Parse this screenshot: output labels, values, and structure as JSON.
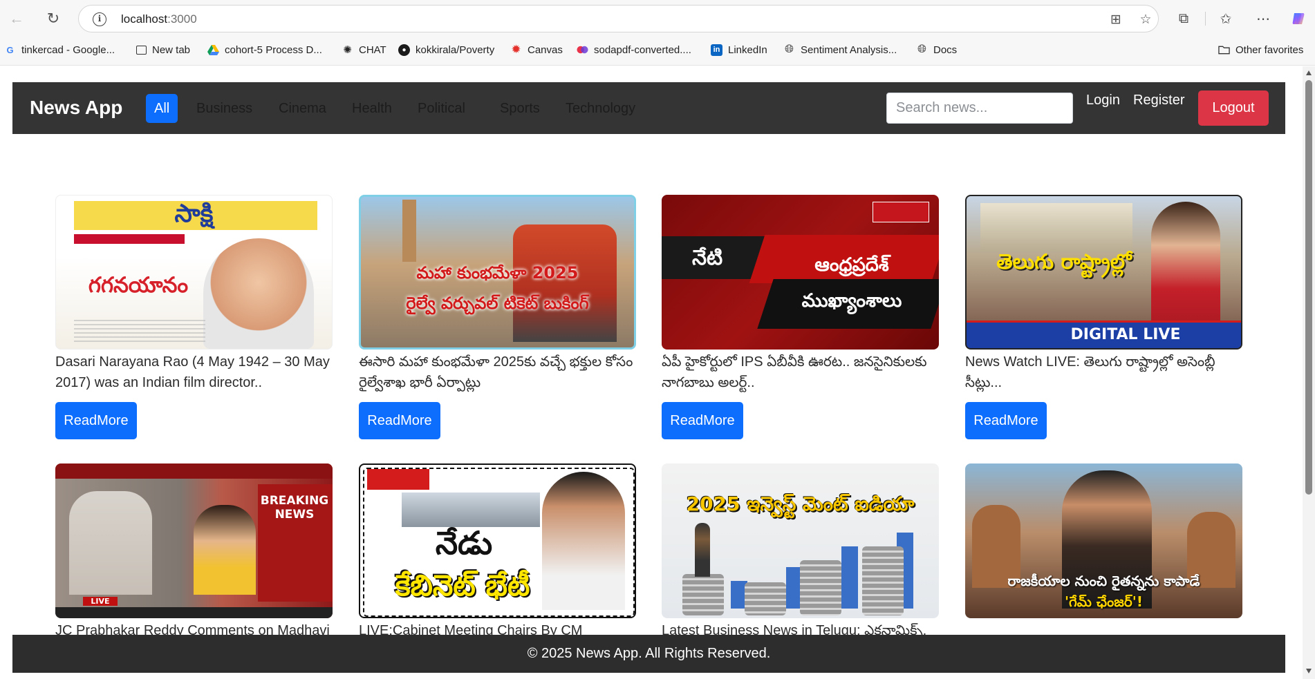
{
  "browser": {
    "url_host": "localhost",
    "url_port": ":3000",
    "bookmarks": [
      {
        "label": "tinkercad - Google...",
        "icon": "google-icon"
      },
      {
        "label": "New tab",
        "icon": "new-tab-icon"
      },
      {
        "label": "cohort-5 Process D...",
        "icon": "drive-icon"
      },
      {
        "label": "CHAT",
        "icon": "chatgpt-icon"
      },
      {
        "label": "kokkirala/Poverty",
        "icon": "github-icon"
      },
      {
        "label": "Canvas",
        "icon": "canvas-icon"
      },
      {
        "label": "sodapdf-converted....",
        "icon": "soda-pdf-icon"
      },
      {
        "label": "LinkedIn",
        "icon": "linkedin-icon"
      },
      {
        "label": "Sentiment Analysis...",
        "icon": "globe-icon"
      },
      {
        "label": "Docs",
        "icon": "globe-icon"
      }
    ],
    "other_favorites": "Other favorites"
  },
  "app": {
    "brand": "News App",
    "categories": [
      "All",
      "Business",
      "Cinema",
      "Health",
      "Political",
      "Sports",
      "Technology"
    ],
    "active_category": "All",
    "search_placeholder": "Search news...",
    "login": "Login",
    "register": "Register",
    "logout": "Logout",
    "readmore": "ReadMore",
    "footer": "© 2025 News App. All Rights Reserved."
  },
  "articles": [
    {
      "title": "Dasari Narayana Rao (4 May 1942 – 30 May 2017) was an Indian film director..",
      "image_text": "సాక్షి",
      "image_sub": "గగనయానం"
    },
    {
      "title": "ఈసారి మహా కుంభమేళా 2025కు వచ్చే భక్తుల కోసం రైల్వేశాఖ భారీ ఏర్పాట్లు",
      "image_text": "మహా కుంభమేళా 2025",
      "image_sub": "రైల్వే వర్చువల్ టికెట్ బుకింగ్"
    },
    {
      "title": "ఏపీ హైకోర్టులో IPS ఏబీవీకి ఊరట.. జనసైనికులకు నాగబాబు అలర్ట్..",
      "image_text": "నేటి",
      "image_sub": "ఆంధ్రప్రదేశ్ ముఖ్యాంశాలు"
    },
    {
      "title": "News Watch LIVE: తెలుగు రాష్ట్రాల్లో అసెంబ్లీ సీట్లు...",
      "image_text": "తెలుగు రాష్ట్రాల్లో",
      "image_sub": "DIGITAL LIVE"
    },
    {
      "title": "JC Prabhakar Reddy Comments on Madhavi",
      "image_text": "BREAKING NEWS",
      "image_sub": "LIVE"
    },
    {
      "title": "LIVE:Cabinet Meeting Chairs By CM",
      "image_text": "నేడు",
      "image_sub": "కేబినెట్ భేటీ"
    },
    {
      "title": "Latest Business News in Telugu: ఎకనామిక్స్,",
      "image_text": "2025 ఇన్వెస్ట్ మెంట్ ఐడియా",
      "image_sub": ""
    },
    {
      "title": "",
      "image_text": "రాజకీయాల నుంచి రైతన్నను కాపాడే",
      "image_sub": "'గేమ్ ఛేంజర్'!"
    }
  ]
}
